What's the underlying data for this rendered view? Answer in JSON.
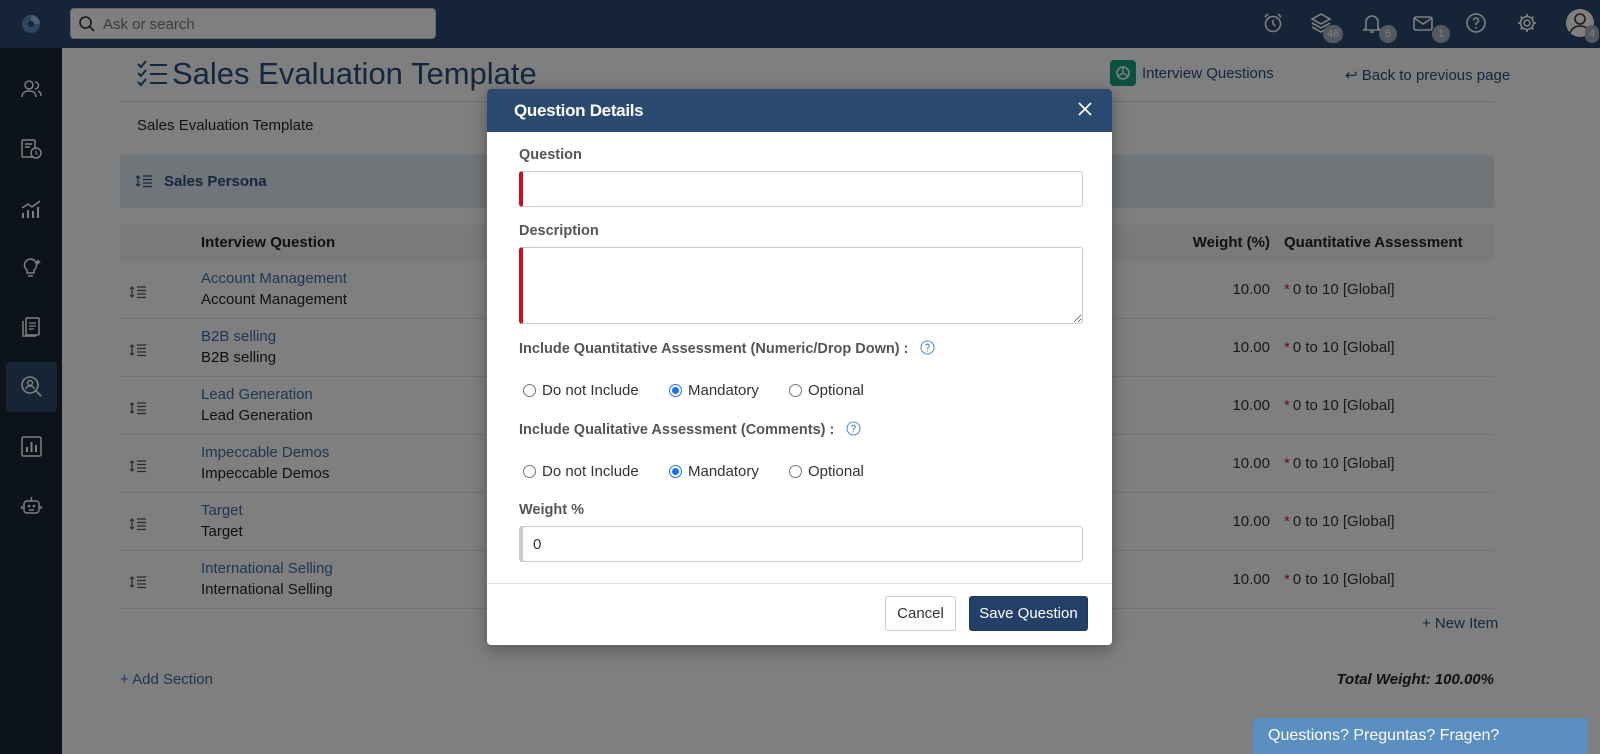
{
  "topbar": {
    "search_placeholder": "Ask or search",
    "badges": {
      "layers": "46",
      "notifications": "5",
      "messages": "1",
      "profile": "4"
    }
  },
  "page": {
    "title": "Sales Evaluation Template",
    "interview_questions_link": "Interview Questions",
    "back_link": "Back to previous page",
    "subtitle": "Sales Evaluation Template",
    "section_name": "Sales Persona",
    "columns": [
      "Interview Question",
      "Weight (%)",
      "Quantitative Assessment"
    ],
    "rows": [
      {
        "title": "Account Management",
        "description": "Account Management",
        "weight": "10.00",
        "assessment": "0 to 10 [Global]"
      },
      {
        "title": "B2B selling",
        "description": "B2B selling",
        "weight": "10.00",
        "assessment": "0 to 10 [Global]"
      },
      {
        "title": "Lead Generation",
        "description": "Lead Generation",
        "weight": "10.00",
        "assessment": "0 to 10 [Global]"
      },
      {
        "title": "Impeccable Demos",
        "description": "Impeccable Demos",
        "weight": "10.00",
        "assessment": "0 to 10 [Global]"
      },
      {
        "title": "Target",
        "description": "Target",
        "weight": "10.00",
        "assessment": "0 to 10 [Global]"
      },
      {
        "title": "International Selling",
        "description": "International Selling",
        "weight": "10.00",
        "assessment": "0 to 10 [Global]"
      }
    ],
    "required_marker": "*",
    "new_item_link": "+ New Item",
    "add_section_link": "+ Add Section",
    "total_weight": "Total Weight: 100.00%"
  },
  "help_widget": "Questions? Preguntas? Fragen?",
  "modal": {
    "title": "Question Details",
    "question_label": "Question",
    "question_value": "",
    "description_label": "Description",
    "description_value": "",
    "quant_label": "Include Quantitative Assessment (Numeric/Drop Down) :",
    "qual_label": "Include Qualitative Assessment (Comments) :",
    "radio_options": [
      "Do not Include",
      "Mandatory",
      "Optional"
    ],
    "quant_selected": "Mandatory",
    "qual_selected": "Mandatory",
    "weight_label": "Weight %",
    "weight_value": "0",
    "cancel_label": "Cancel",
    "save_label": "Save Question"
  },
  "colors": {
    "topbar": "#2b4a6f",
    "sidebar": "#182637",
    "link": "#2b4f7c",
    "required": "#c8101e",
    "primary_button": "#234168",
    "help_widget": "#5b8ec1"
  }
}
